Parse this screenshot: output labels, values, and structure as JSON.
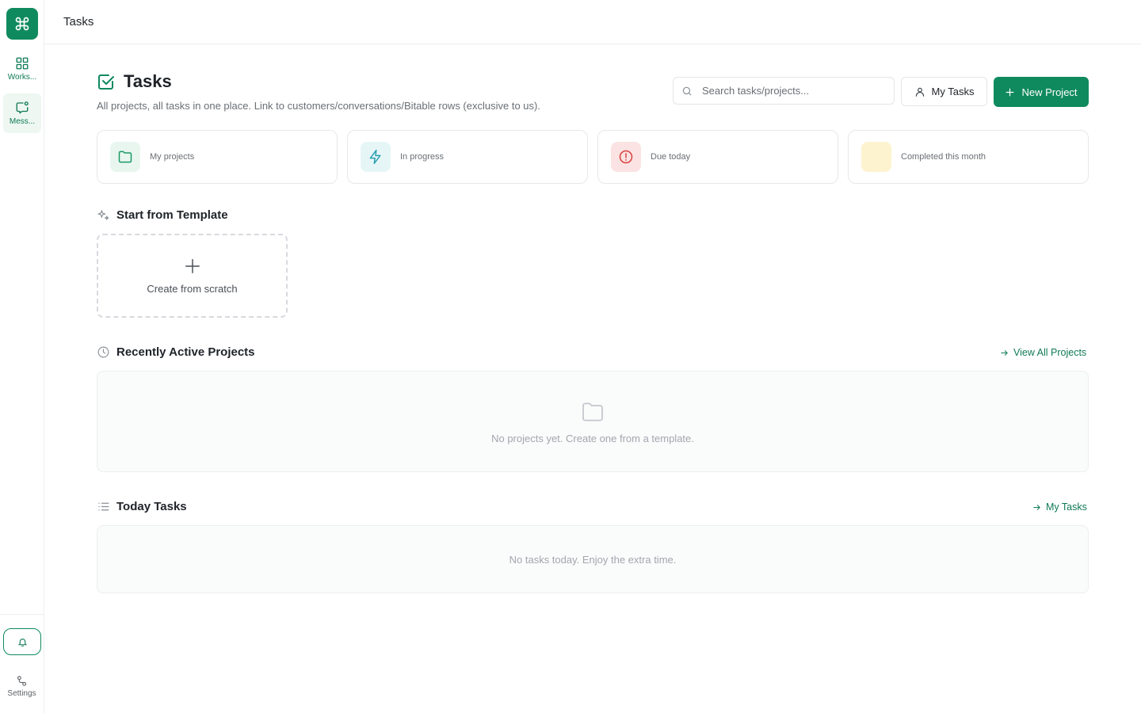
{
  "sidebar": {
    "logo_icon": "command-icon",
    "items": [
      {
        "label": "Works...",
        "icon": "grid-icon"
      },
      {
        "label": "Mess...",
        "icon": "message-icon"
      }
    ],
    "notifications_icon": "bell-icon",
    "settings": {
      "label": "Settings",
      "icon": "settings-icon"
    }
  },
  "topbar": {
    "title": "Tasks"
  },
  "header": {
    "title": "Tasks",
    "subtitle": "All projects, all tasks in one place. Link to customers/conversations/Bitable rows (exclusive to us).",
    "search_placeholder": "Search tasks/projects...",
    "my_tasks_label": "My Tasks",
    "new_project_label": "New Project"
  },
  "stats": [
    {
      "label": "My projects",
      "icon": "folder-icon",
      "bg": "#e8f6ef",
      "color": "#1a9a67"
    },
    {
      "label": "In progress",
      "icon": "lightning-icon",
      "bg": "#e6f6f7",
      "color": "#2a9fb0"
    },
    {
      "label": "Due today",
      "icon": "alert-circle-icon",
      "bg": "#fbe3e3",
      "color": "#d9413f"
    },
    {
      "label": "Completed this month",
      "icon": "check-icon",
      "bg": "#fdf3cf",
      "color": "#e0b12a"
    }
  ],
  "templates": {
    "title": "Start from Template",
    "create_label": "Create from scratch"
  },
  "recent_projects": {
    "title": "Recently Active Projects",
    "link_label": "View All Projects",
    "empty_text": "No projects yet. Create one from a template."
  },
  "today_tasks": {
    "title": "Today Tasks",
    "link_label": "My Tasks",
    "empty_text": "No tasks today. Enjoy the extra time."
  },
  "colors": {
    "accent": "#0f8a5f",
    "link": "#0f7a55"
  }
}
